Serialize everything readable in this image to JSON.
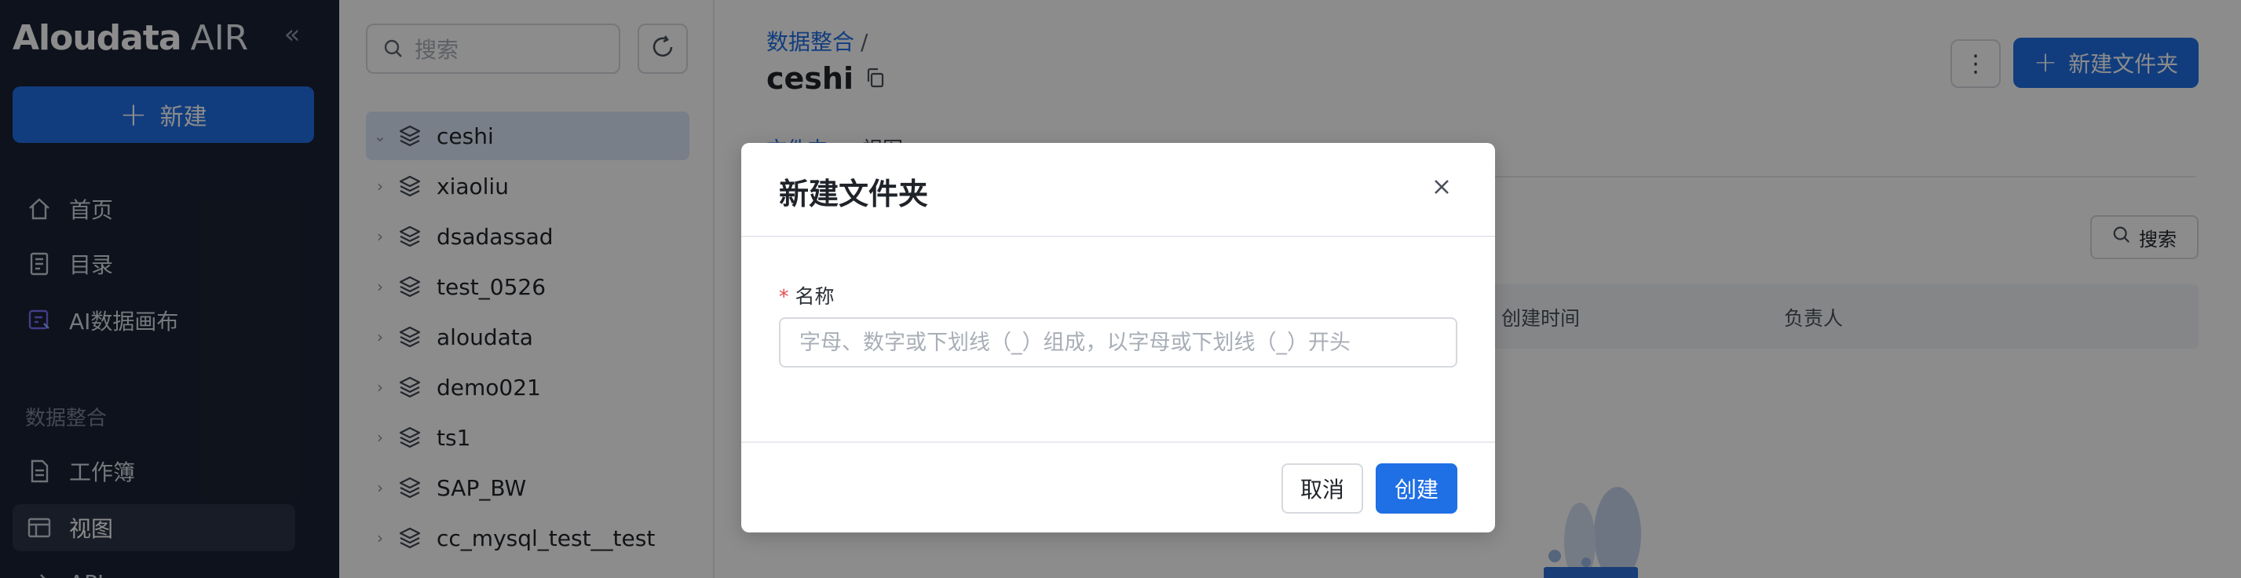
{
  "app": {
    "logo_bold": "Aloudata",
    "logo_text": "AIR",
    "new_button": "新建"
  },
  "nav": {
    "items": [
      {
        "label": "首页",
        "icon": "home-icon"
      },
      {
        "label": "目录",
        "icon": "catalog-icon"
      },
      {
        "label": "AI数据画布",
        "icon": "ai-canvas-icon"
      }
    ],
    "section_label": "数据整合",
    "section_items": [
      {
        "label": "工作簿",
        "icon": "workbook-icon"
      },
      {
        "label": "视图",
        "icon": "view-icon",
        "active": true
      },
      {
        "label": "API",
        "icon": "api-icon"
      }
    ]
  },
  "tree": {
    "search_placeholder": "搜索",
    "items": [
      {
        "label": "ceshi",
        "selected": true
      },
      {
        "label": "xiaoliu"
      },
      {
        "label": "dsadassad"
      },
      {
        "label": "test_0526"
      },
      {
        "label": "aloudata"
      },
      {
        "label": "demo021"
      },
      {
        "label": "ts1"
      },
      {
        "label": "SAP_BW"
      },
      {
        "label": "cc_mysql_test__test"
      }
    ]
  },
  "main": {
    "breadcrumb": "数据整合",
    "breadcrumb_sep": "/",
    "title": "ceshi",
    "tabs": [
      "文件夹",
      "视图"
    ],
    "new_folder_button": "新建文件夹",
    "search_button": "搜索",
    "columns": {
      "created_time": "创建时间",
      "owner": "负责人"
    }
  },
  "modal": {
    "title": "新建文件夹",
    "field_label": "名称",
    "field_value": "",
    "field_placeholder": "字母、数字或下划线（_）组成，以字母或下划线（_）开头",
    "cancel": "取消",
    "ok": "创建"
  },
  "colors": {
    "primary": "#1f6fe5",
    "nav_bg": "#1a2233",
    "required": "#e5484d"
  }
}
